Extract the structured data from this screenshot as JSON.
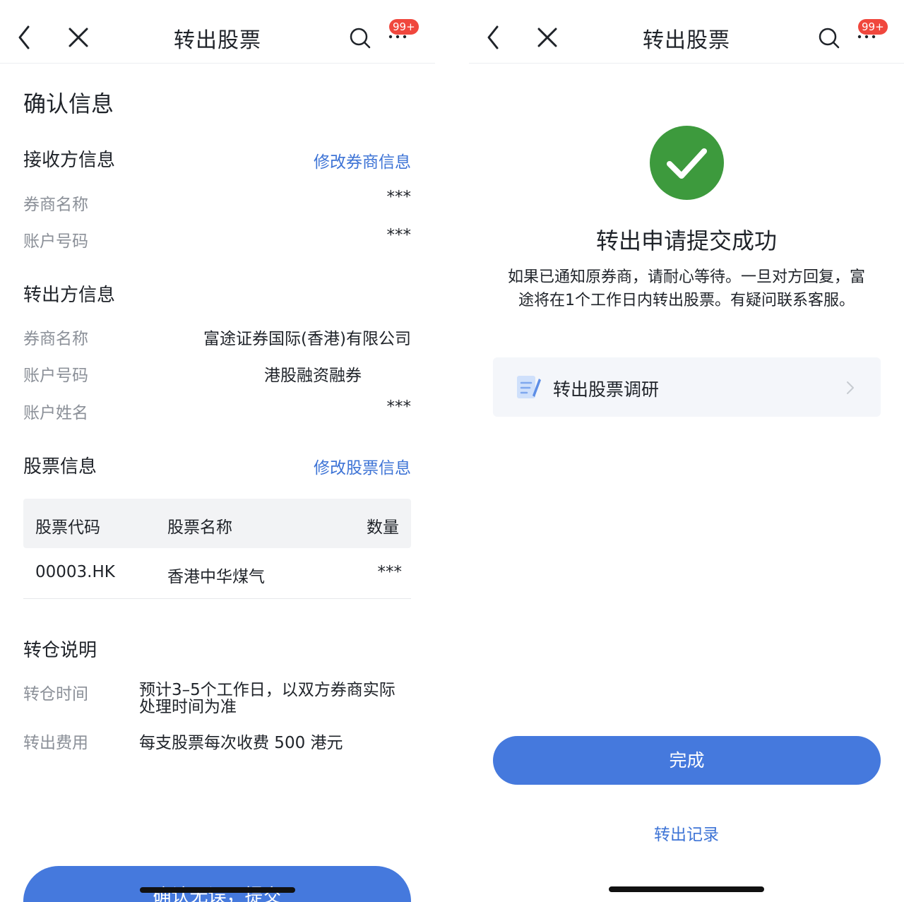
{
  "left": {
    "nav": {
      "title": "转出股票",
      "badge": "99+"
    },
    "heading": "确认信息",
    "receiver": {
      "title": "接收方信息",
      "edit_link": "修改券商信息",
      "broker_label": "券商名称",
      "broker_value": "***",
      "account_label": "账户号码",
      "account_value": "***"
    },
    "sender": {
      "title": "转出方信息",
      "broker_label": "券商名称",
      "broker_value": "富途证券国际(香港)有限公司",
      "account_label": "账户号码",
      "account_value": "港股融资融券",
      "name_label": "账户姓名",
      "name_value": "***"
    },
    "stock": {
      "title": "股票信息",
      "edit_link": "修改股票信息",
      "columns": {
        "code": "股票代码",
        "name": "股票名称",
        "qty": "数量"
      },
      "rows": [
        {
          "code": "00003.HK",
          "name": "香港中华煤气",
          "qty": "***"
        }
      ]
    },
    "notes": {
      "title": "转仓说明",
      "time_label": "转仓时间",
      "time_line1": "预计3–5个工作日，以双方券商实际",
      "time_line2": "处理时间为准",
      "fee_label": "转出费用",
      "fee_value": "每支股票每次收费 500 港元"
    },
    "submit_label": "确认无误，提交"
  },
  "right": {
    "nav": {
      "title": "转出股票",
      "badge": "99+"
    },
    "success_title": "转出申请提交成功",
    "success_line1": "如果已通知原券商，请耐心等待。一旦对方回复，富",
    "success_line2": "途将在1个工作日内转出股票。有疑问联系客服。",
    "survey_label": "转出股票调研",
    "done_label": "完成",
    "record_link": "转出记录"
  },
  "colors": {
    "accent": "#4579dd",
    "link": "#3e74d6",
    "success": "#3d9a3d",
    "badge": "#f0473d",
    "muted": "#8b9098"
  },
  "icons": [
    "back-icon",
    "close-icon",
    "search-icon",
    "more-icon",
    "check-icon",
    "document-icon",
    "chevron-right-icon"
  ]
}
